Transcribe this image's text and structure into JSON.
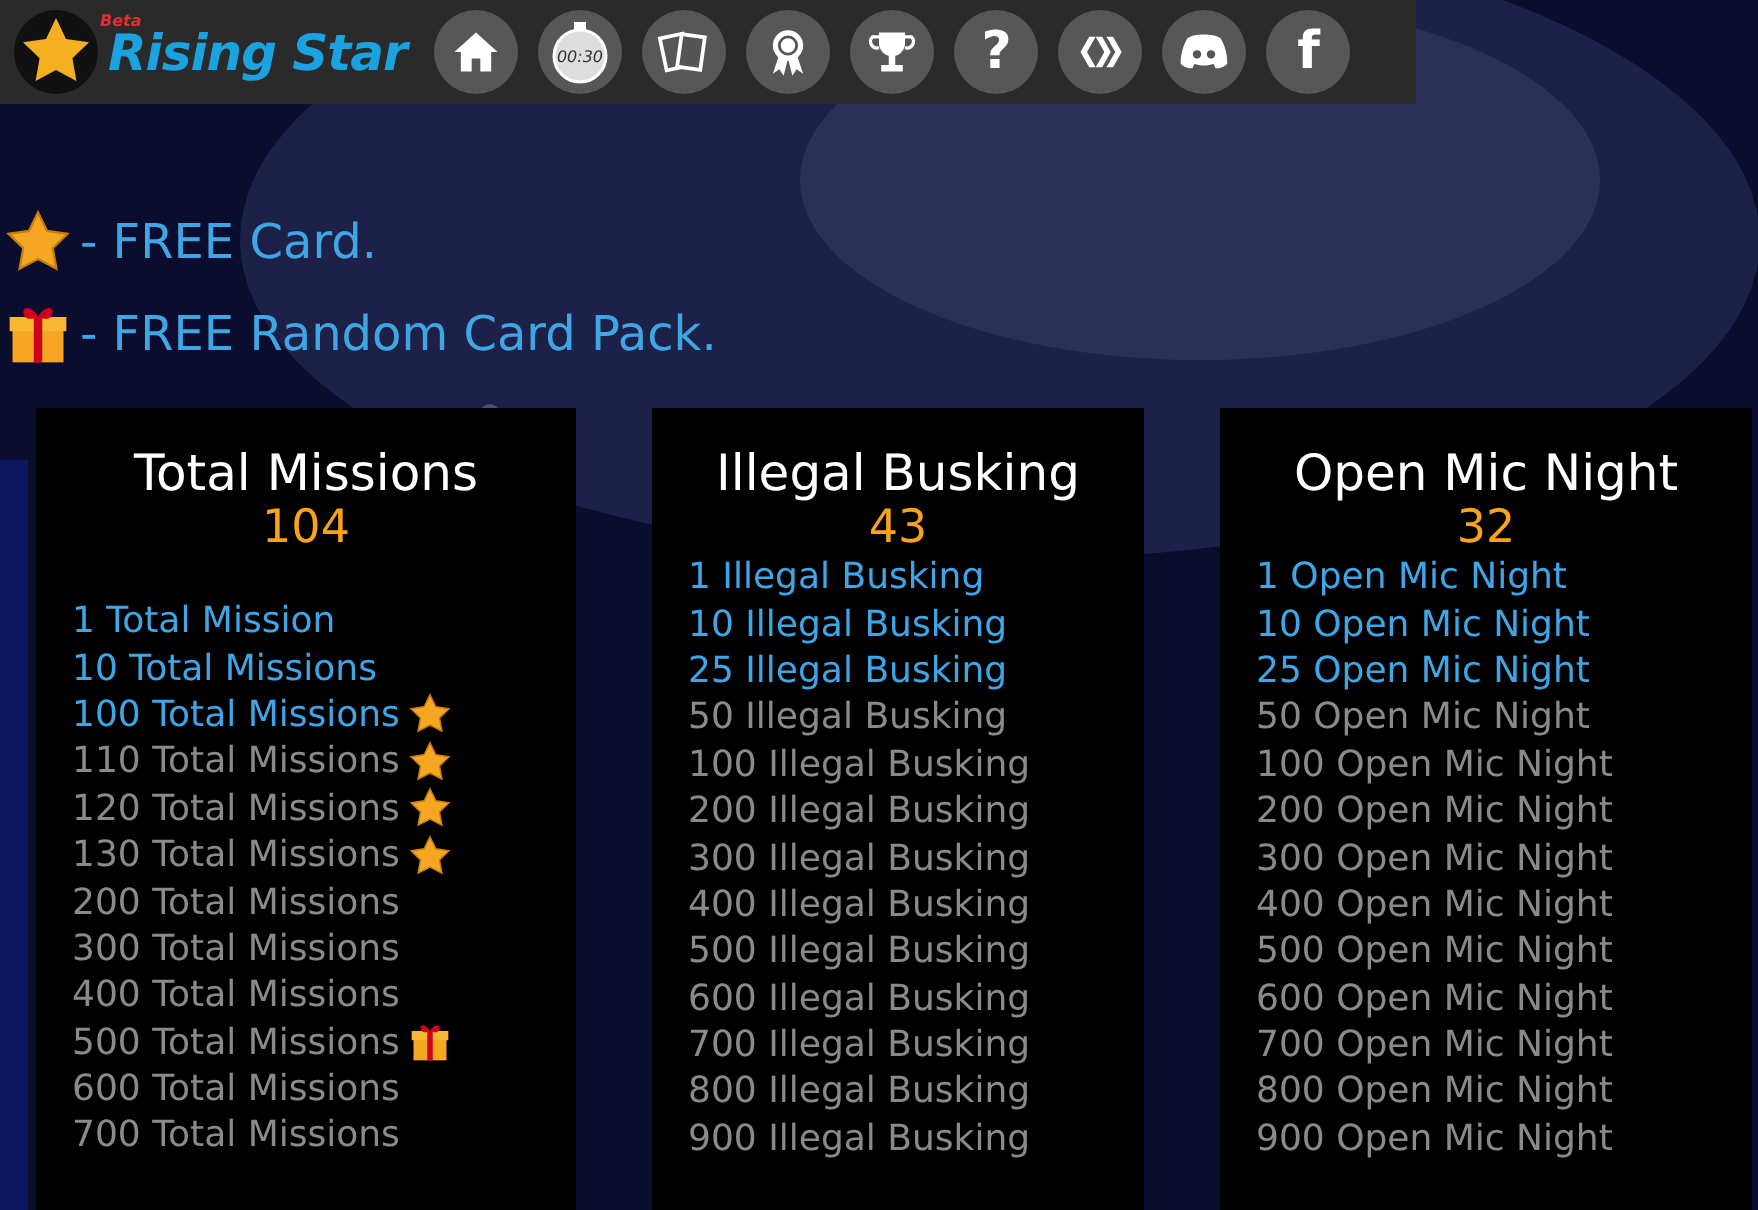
{
  "header": {
    "logo_text": "Rising Star",
    "badge": "Beta",
    "nav": [
      {
        "kind": "home"
      },
      {
        "kind": "timer",
        "glyph": "00:30"
      },
      {
        "kind": "cards"
      },
      {
        "kind": "ribbon"
      },
      {
        "kind": "trophy"
      },
      {
        "kind": "help",
        "glyph": "?"
      },
      {
        "kind": "hive"
      },
      {
        "kind": "discord"
      },
      {
        "kind": "facebook",
        "glyph": "f"
      }
    ]
  },
  "legend": [
    {
      "kind": "card",
      "text": "- FREE Card."
    },
    {
      "kind": "pack",
      "text": "- FREE Random Card Pack."
    }
  ],
  "panels": [
    {
      "title": "Total Missions",
      "count": "104",
      "items": [
        {
          "text": "1 Total Mission",
          "done": true,
          "kind": "plain"
        },
        {
          "text": "10 Total Missions",
          "done": true,
          "kind": "plain"
        },
        {
          "text": "100 Total Missions",
          "done": true,
          "kind": "card"
        },
        {
          "text": "110 Total Missions",
          "done": false,
          "kind": "card"
        },
        {
          "text": "120 Total Missions",
          "done": false,
          "kind": "card"
        },
        {
          "text": "130 Total Missions",
          "done": false,
          "kind": "card"
        },
        {
          "text": "200 Total Missions",
          "done": false,
          "kind": "plain"
        },
        {
          "text": "300 Total Missions",
          "done": false,
          "kind": "plain"
        },
        {
          "text": "400 Total Missions",
          "done": false,
          "kind": "plain"
        },
        {
          "text": "500 Total Missions",
          "done": false,
          "kind": "pack"
        },
        {
          "text": "600 Total Missions",
          "done": false,
          "kind": "plain"
        },
        {
          "text": "700 Total Missions",
          "done": false,
          "kind": "plain"
        }
      ]
    },
    {
      "title": "Illegal Busking",
      "count": "43",
      "items": [
        {
          "text": "1 Illegal Busking",
          "done": true
        },
        {
          "text": "10 Illegal Busking",
          "done": true
        },
        {
          "text": "25 Illegal Busking",
          "done": true
        },
        {
          "text": "50 Illegal Busking",
          "done": false
        },
        {
          "text": "100 Illegal Busking",
          "done": false
        },
        {
          "text": "200 Illegal Busking",
          "done": false
        },
        {
          "text": "300 Illegal Busking",
          "done": false
        },
        {
          "text": "400 Illegal Busking",
          "done": false
        },
        {
          "text": "500 Illegal Busking",
          "done": false
        },
        {
          "text": "600 Illegal Busking",
          "done": false
        },
        {
          "text": "700 Illegal Busking",
          "done": false
        },
        {
          "text": "800 Illegal Busking",
          "done": false
        },
        {
          "text": "900 Illegal Busking",
          "done": false
        }
      ]
    },
    {
      "title": "Open Mic Night",
      "count": "32",
      "items": [
        {
          "text": "1 Open Mic Night",
          "done": true
        },
        {
          "text": "10 Open Mic Night",
          "done": true
        },
        {
          "text": "25 Open Mic Night",
          "done": true
        },
        {
          "text": "50 Open Mic Night",
          "done": false
        },
        {
          "text": "100 Open Mic Night",
          "done": false
        },
        {
          "text": "200 Open Mic Night",
          "done": false
        },
        {
          "text": "300 Open Mic Night",
          "done": false
        },
        {
          "text": "400 Open Mic Night",
          "done": false
        },
        {
          "text": "500 Open Mic Night",
          "done": false
        },
        {
          "text": "600 Open Mic Night",
          "done": false
        },
        {
          "text": "700 Open Mic Night",
          "done": false
        },
        {
          "text": "800 Open Mic Night",
          "done": false
        },
        {
          "text": "900 Open Mic Night",
          "done": false
        }
      ]
    }
  ]
}
